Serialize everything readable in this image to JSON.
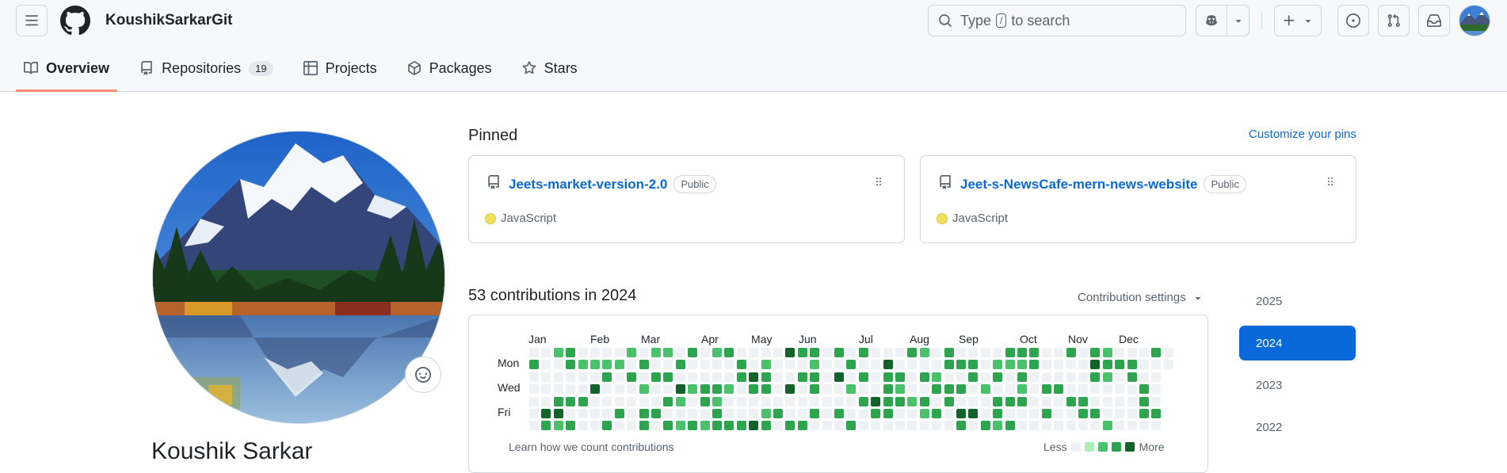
{
  "header": {
    "username": "KoushikSarkarGit",
    "search_prefix": "Type",
    "search_key": "/",
    "search_suffix": "to search"
  },
  "tabs": [
    {
      "label": "Overview",
      "active": true,
      "icon": "book-icon"
    },
    {
      "label": "Repositories",
      "count": "19",
      "icon": "repo-icon"
    },
    {
      "label": "Projects",
      "icon": "table-icon"
    },
    {
      "label": "Packages",
      "icon": "package-icon"
    },
    {
      "label": "Stars",
      "icon": "star-icon"
    }
  ],
  "profile": {
    "name": "Koushik Sarkar"
  },
  "pinned": {
    "title": "Pinned",
    "customize": "Customize your pins",
    "repos": [
      {
        "name": "Jeets-market-version-2.0",
        "visibility": "Public",
        "language": "JavaScript",
        "lang_color": "#f1e05a"
      },
      {
        "name": "Jeet-s-NewsCafe-mern-news-website",
        "visibility": "Public",
        "language": "JavaScript",
        "lang_color": "#f1e05a"
      }
    ]
  },
  "contributions": {
    "title": "53 contributions in 2024",
    "settings": "Contribution settings",
    "months": [
      "Jan",
      "Feb",
      "Mar",
      "Apr",
      "May",
      "Jun",
      "Jul",
      "Aug",
      "Sep",
      "Oct",
      "Nov",
      "Dec"
    ],
    "days": [
      "Mon",
      "Wed",
      "Fri"
    ],
    "learn": "Learn how we count contributions",
    "less": "Less",
    "more": "More",
    "level_colors": [
      "#eff2f5",
      "#aceebb",
      "#4ac26b",
      "#2da44e",
      "#116329"
    ]
  },
  "years": [
    {
      "label": "2025",
      "active": false
    },
    {
      "label": "2024",
      "active": true
    },
    {
      "label": "2023",
      "active": false
    },
    {
      "label": "2022",
      "active": false
    }
  ]
}
